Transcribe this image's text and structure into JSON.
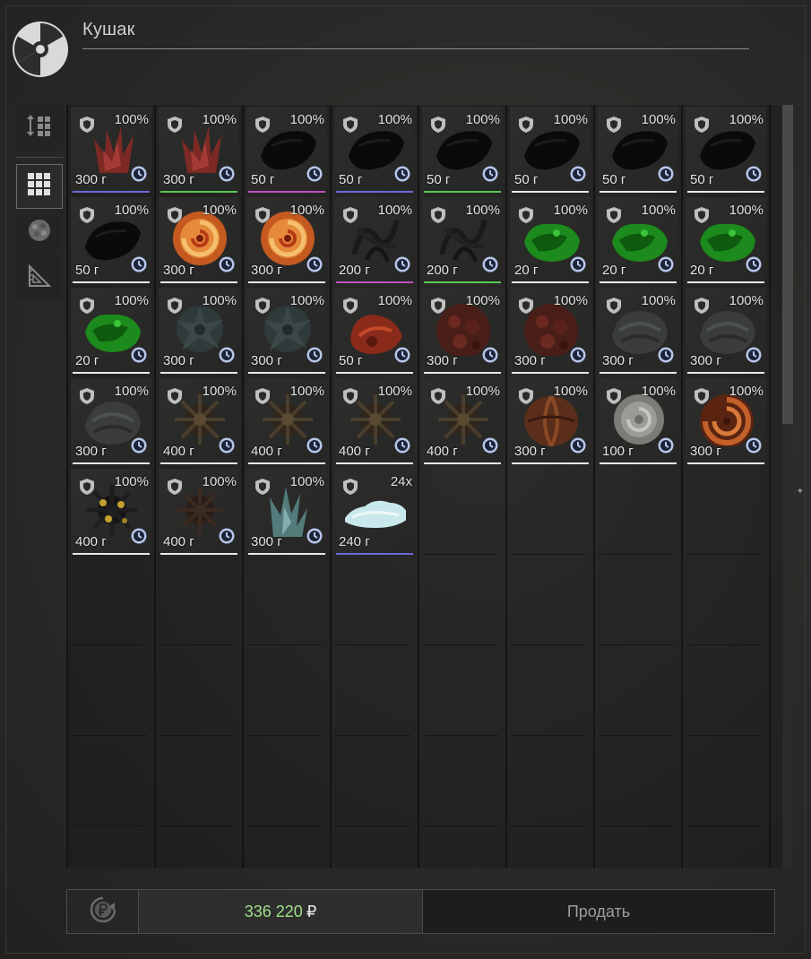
{
  "window": {
    "title": "Кушак"
  },
  "side_tabs": [
    {
      "icon": "sort-grid-icon"
    },
    {
      "icon": "grid-view-icon"
    },
    {
      "icon": "artifact-filter-icon"
    },
    {
      "icon": "ruler-triangle-icon"
    }
  ],
  "colors": {
    "money": "#9fe08a",
    "sell_text": "#9c9c9a"
  },
  "items": [
    {
      "pct": "100%",
      "weight": "300 г",
      "art": "red-crystal",
      "line": "#6a6ad8"
    },
    {
      "pct": "100%",
      "weight": "300 г",
      "art": "red-crystal",
      "line": "#58c858"
    },
    {
      "pct": "100%",
      "weight": "50 г",
      "art": "black-blob",
      "line": "#c050c0"
    },
    {
      "pct": "100%",
      "weight": "50 г",
      "art": "black-blob",
      "line": "#6a6ad8"
    },
    {
      "pct": "100%",
      "weight": "50 г",
      "art": "black-blob",
      "line": "#58c858"
    },
    {
      "pct": "100%",
      "weight": "50 г",
      "art": "black-blob",
      "line": "#e8e8e8"
    },
    {
      "pct": "100%",
      "weight": "50 г",
      "art": "black-blob",
      "line": "#e8e8e8"
    },
    {
      "pct": "100%",
      "weight": "50 г",
      "art": "black-blob",
      "line": "#e8e8e8"
    },
    {
      "pct": "100%",
      "weight": "50 г",
      "art": "black-blob",
      "line": "#e8e8e8"
    },
    {
      "pct": "100%",
      "weight": "300 г",
      "art": "fire-swirl",
      "line": "#e8e8e8"
    },
    {
      "pct": "100%",
      "weight": "300 г",
      "art": "fire-swirl",
      "line": "#e8e8e8"
    },
    {
      "pct": "100%",
      "weight": "200 г",
      "art": "dark-tangle",
      "line": "#c050c0"
    },
    {
      "pct": "100%",
      "weight": "200 г",
      "art": "dark-tangle",
      "line": "#58c858"
    },
    {
      "pct": "100%",
      "weight": "20 г",
      "art": "green-goo",
      "line": "#e8e8e8"
    },
    {
      "pct": "100%",
      "weight": "20 г",
      "art": "green-goo",
      "line": "#e8e8e8"
    },
    {
      "pct": "100%",
      "weight": "20 г",
      "art": "green-goo",
      "line": "#e8e8e8"
    },
    {
      "pct": "100%",
      "weight": "20 г",
      "art": "green-goo",
      "line": "#e8e8e8"
    },
    {
      "pct": "100%",
      "weight": "300 г",
      "art": "grey-flower",
      "line": "#e8e8e8"
    },
    {
      "pct": "100%",
      "weight": "300 г",
      "art": "grey-flower",
      "line": "#e8e8e8"
    },
    {
      "pct": "100%",
      "weight": "50 г",
      "art": "red-lump",
      "line": "#e8e8e8"
    },
    {
      "pct": "100%",
      "weight": "300 г",
      "art": "red-sphere",
      "line": "#e8e8e8"
    },
    {
      "pct": "100%",
      "weight": "300 г",
      "art": "red-sphere",
      "line": "#e8e8e8"
    },
    {
      "pct": "100%",
      "weight": "300 г",
      "art": "grey-shell",
      "line": "#e8e8e8"
    },
    {
      "pct": "100%",
      "weight": "300 г",
      "art": "grey-shell",
      "line": "#e8e8e8"
    },
    {
      "pct": "100%",
      "weight": "300 г",
      "art": "grey-shell",
      "line": "#e8e8e8"
    },
    {
      "pct": "100%",
      "weight": "400 г",
      "art": "spiky-ball",
      "line": "#e8e8e8"
    },
    {
      "pct": "100%",
      "weight": "400 г",
      "art": "spiky-ball",
      "line": "#e8e8e8"
    },
    {
      "pct": "100%",
      "weight": "400 г",
      "art": "spiky-ball",
      "line": "#e8e8e8"
    },
    {
      "pct": "100%",
      "weight": "400 г",
      "art": "spiky-ball",
      "line": "#e8e8e8"
    },
    {
      "pct": "100%",
      "weight": "300 г",
      "art": "brown-cocoon",
      "line": "#e8e8e8"
    },
    {
      "pct": "100%",
      "weight": "100 г",
      "art": "white-rose",
      "line": "#e8e8e8"
    },
    {
      "pct": "100%",
      "weight": "300 г",
      "art": "orange-coil",
      "line": "#e8e8e8"
    },
    {
      "pct": "100%",
      "weight": "400 г",
      "art": "gold-spike-ball",
      "line": "#e8e8e8"
    },
    {
      "pct": "100%",
      "weight": "400 г",
      "art": "dark-spike-ball",
      "line": "#e8e8e8"
    },
    {
      "pct": "100%",
      "weight": "300 г",
      "art": "teal-crystal",
      "line": "#e8e8e8"
    },
    {
      "pct": "24x",
      "weight": "240 г",
      "art": "salt-pile",
      "line": "#6a6ad8"
    }
  ],
  "footer": {
    "money": "336 220",
    "currency": "₽",
    "sell_label": "Продать"
  }
}
